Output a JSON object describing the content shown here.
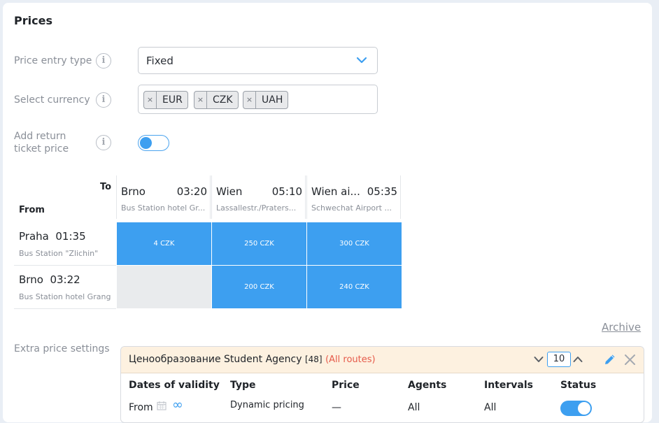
{
  "prices": {
    "title": "Prices",
    "price_entry_type": {
      "label": "Price entry type",
      "value": "Fixed"
    },
    "select_currency": {
      "label": "Select currency",
      "tags": [
        "EUR",
        "CZK",
        "UAH"
      ],
      "remove_glyph": "×"
    },
    "return_ticket": {
      "label_line1": "Add return",
      "label_line2": "ticket price",
      "enabled": false
    },
    "info_glyph": "i"
  },
  "matrix": {
    "to_label": "To",
    "from_label": "From",
    "columns": [
      {
        "city": "Brno",
        "time": "03:20",
        "stop": "Bus Station hotel Gr..."
      },
      {
        "city": "Wien",
        "time": "05:10",
        "stop": "Lassallestr./Praters..."
      },
      {
        "city": "Wien ai...",
        "time": "05:35",
        "stop": "Schwechat Airport ..."
      }
    ],
    "rows": [
      {
        "city": "Praha",
        "time": "01:35",
        "stop": "Bus Station \"Zlichin\"",
        "cells": [
          "4 CZK",
          "250 CZK",
          "300 CZK"
        ]
      },
      {
        "city": "Brno",
        "time": "03:22",
        "stop": "Bus Station hotel Grang",
        "cells": [
          "",
          "200 CZK",
          "240 CZK"
        ]
      }
    ]
  },
  "archive_link": "Archive",
  "extra": {
    "label": "Extra price settings",
    "panel": {
      "title": "Ценообразование Student Agency",
      "count": "[48]",
      "scope": "(All routes)",
      "page_value": "10"
    },
    "headers": [
      "Dates of validity",
      "Type",
      "Price",
      "Agents",
      "Intervals",
      "Status"
    ],
    "row": {
      "dates": "From",
      "infinity": "∞",
      "type": "Dynamic pricing",
      "price": "—",
      "agents": "All",
      "intervals": "All",
      "status": true
    }
  },
  "colors": {
    "accent": "#3d9ff0",
    "muted": "#8a8f98",
    "panel_header": "#fdf1e0",
    "scope_red": "#e65a4a"
  },
  "icons": [
    "info-icon",
    "chevron-down-icon",
    "remove-tag-icon",
    "calendar-icon",
    "infinity-icon",
    "chevron-up-icon",
    "pencil-icon",
    "close-icon"
  ]
}
